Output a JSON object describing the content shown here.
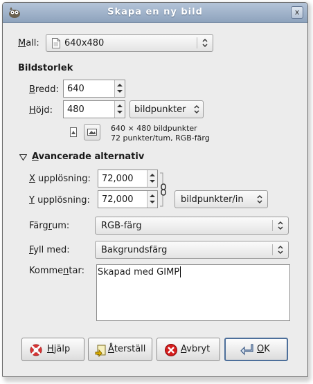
{
  "window": {
    "title": "Skapa en ny bild",
    "close_label": "x"
  },
  "template": {
    "label_prefix": "",
    "label_key": "M",
    "label_rest": "all:",
    "value": "640x480"
  },
  "image_size": {
    "heading": "Bildstorlek",
    "width_label_key": "B",
    "width_label_rest": "redd:",
    "width_value": "640",
    "height_label_key": "H",
    "height_label_rest": "öjd:",
    "height_value": "480",
    "unit": "bildpunkter",
    "info_line1": "640 × 480 bildpunkter",
    "info_line2": "72 punkter/tum, RGB-färg"
  },
  "advanced": {
    "heading_key": "A",
    "heading_rest": "vancerade alternativ",
    "xres_label_key": "X",
    "xres_label_rest": " upplösning:",
    "xres_value": "72,000",
    "yres_label_key": "Y",
    "yres_label_rest": " upplösning:",
    "yres_value": "72,000",
    "res_unit": "bildpunkter/in",
    "colorspace_label_pre": "Färg",
    "colorspace_label_key": "r",
    "colorspace_label_rest": "um:",
    "colorspace_value": "RGB-färg",
    "fill_label_key": "F",
    "fill_label_rest": "yll med:",
    "fill_value": "Bakgrundsfärg",
    "comment_label_pre": "Komme",
    "comment_label_key": "n",
    "comment_label_rest": "tar:",
    "comment_value": "Skapad med GIMP"
  },
  "buttons": {
    "help_key": "H",
    "help_rest": "jälp",
    "reset_key": "Å",
    "reset_rest": "terställ",
    "cancel_key": "A",
    "cancel_rest": "vbryt",
    "ok_key": "O",
    "ok_rest": "K"
  },
  "icons": {
    "app": "gimp-wilber-icon",
    "template": "document-icon",
    "portrait": "portrait-orientation-icon",
    "landscape": "landscape-orientation-icon",
    "chain": "chain-link-icon",
    "help": "lifebuoy-icon",
    "reset": "revert-icon",
    "cancel": "cancel-icon",
    "ok": "enter-arrow-icon"
  }
}
